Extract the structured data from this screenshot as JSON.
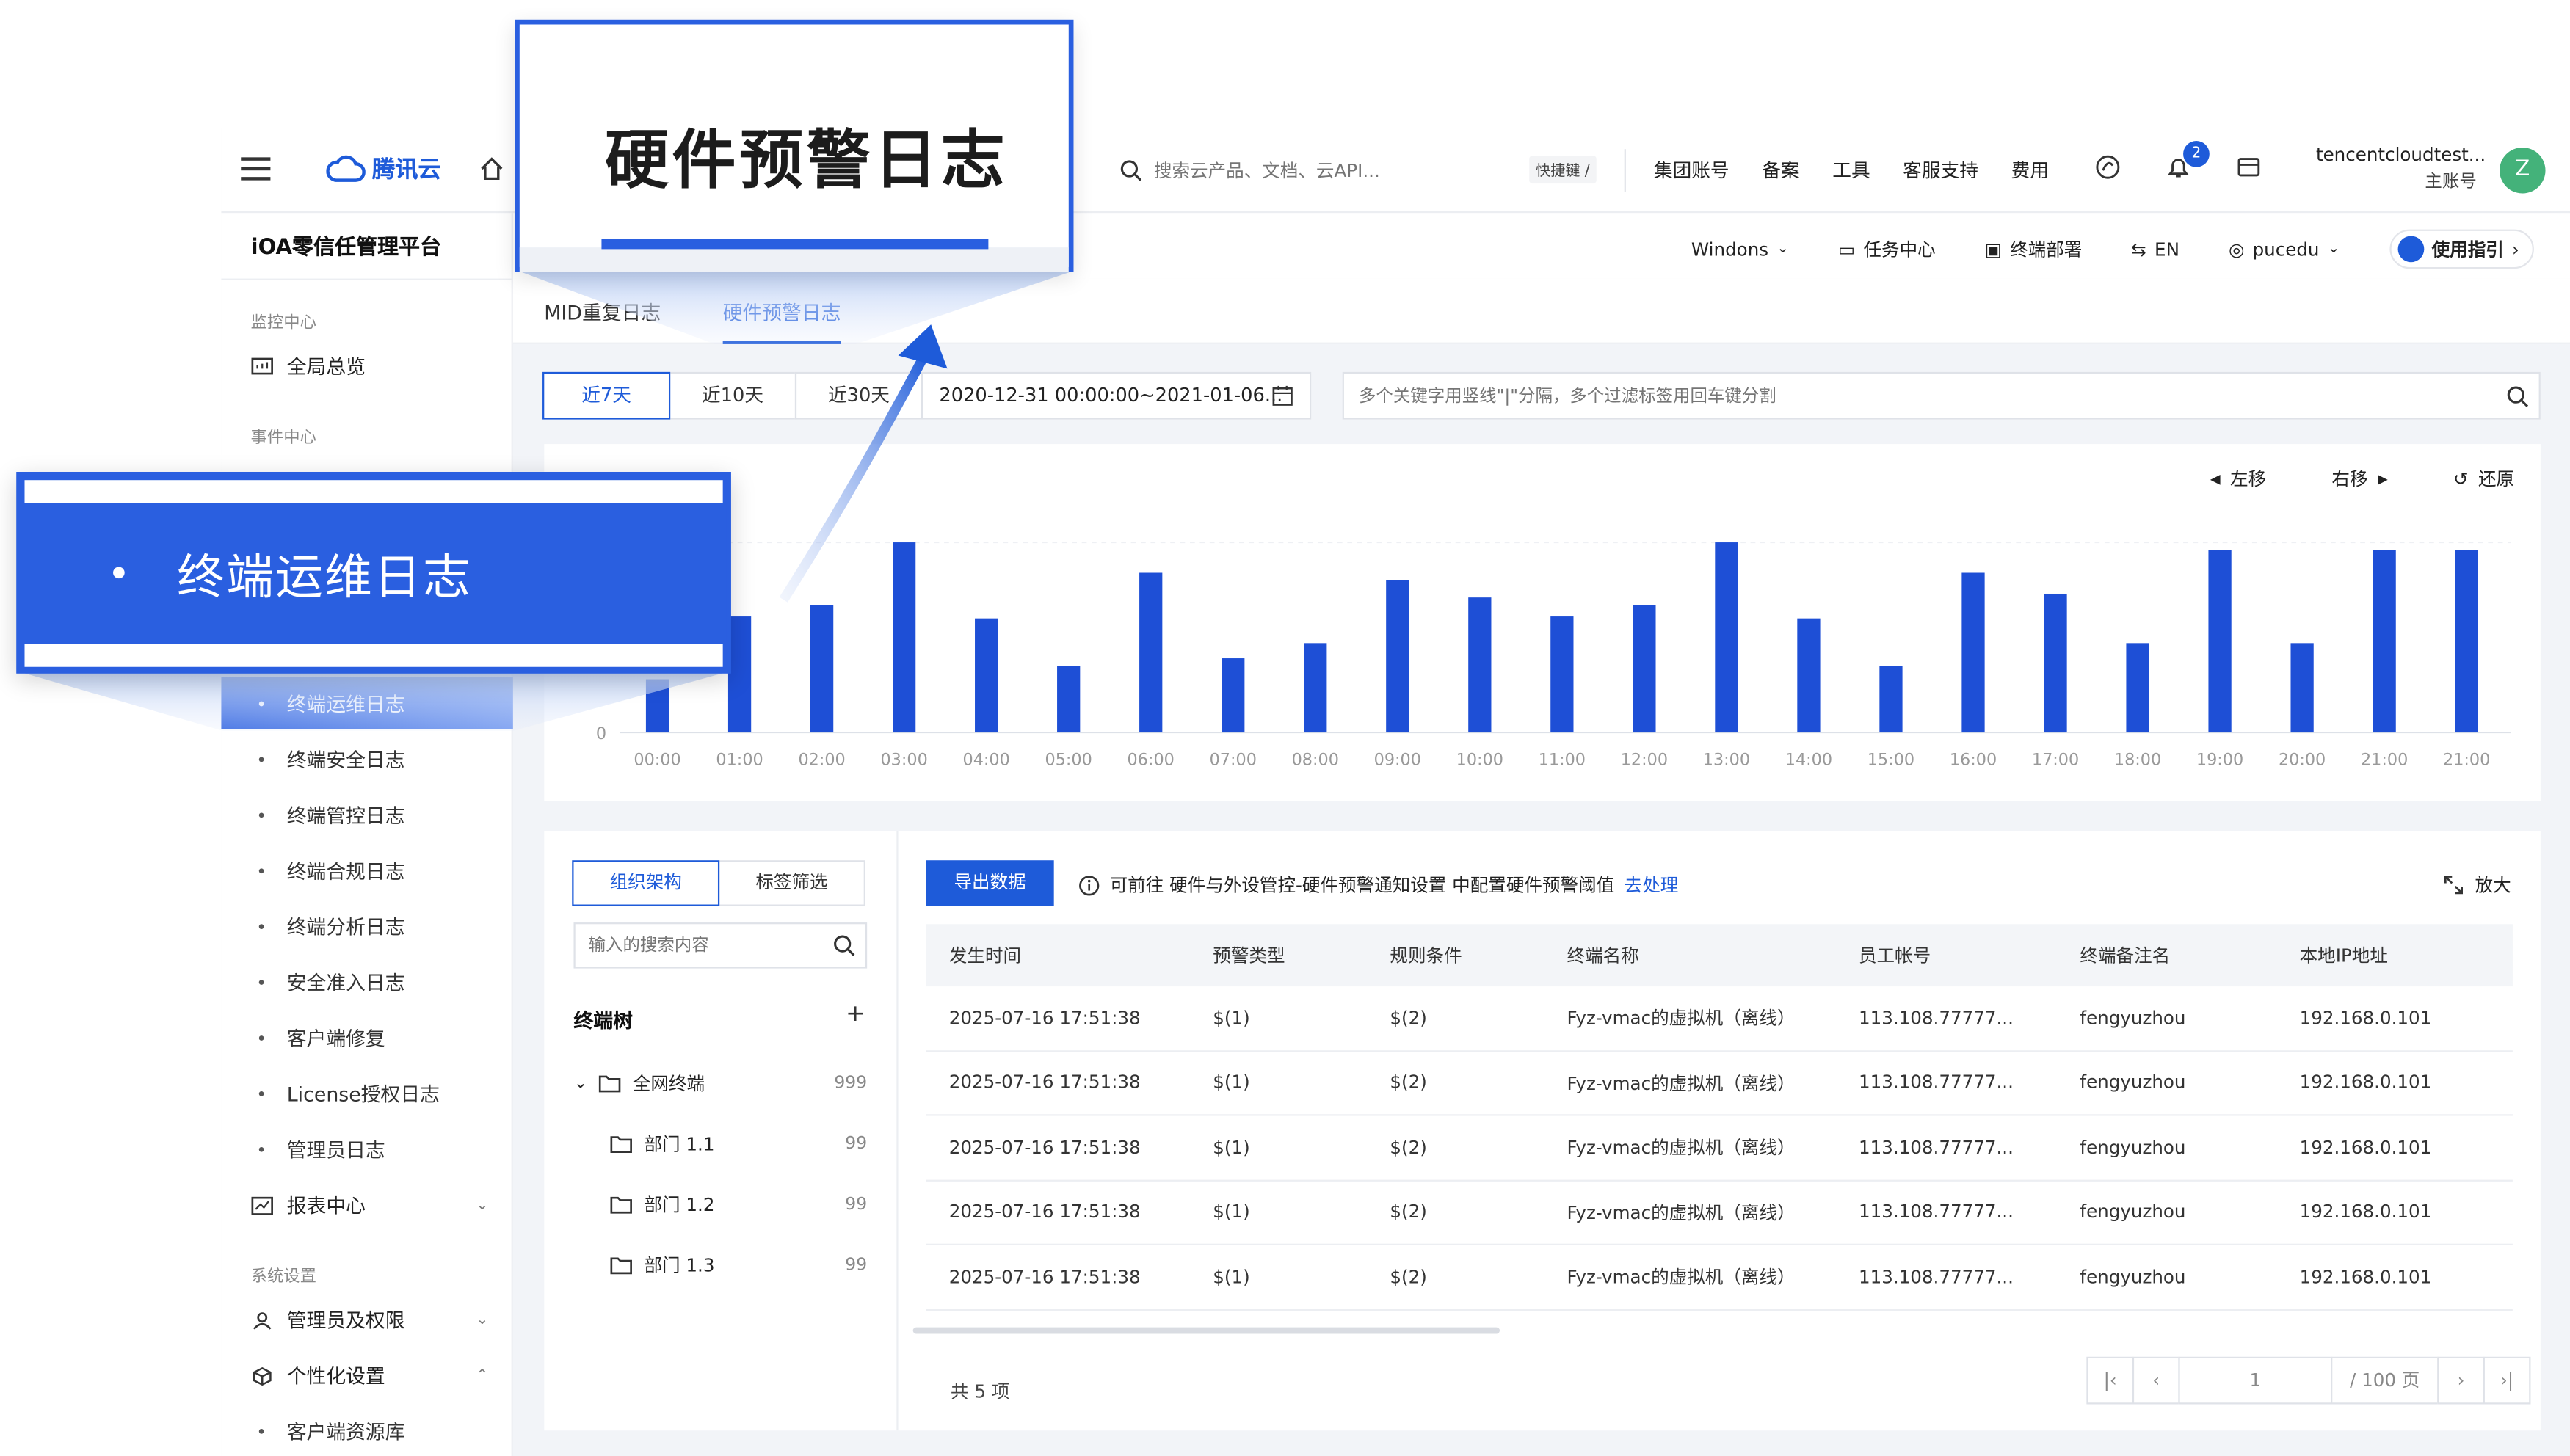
{
  "topbar": {
    "brand": "腾讯云",
    "search_placeholder": "搜索云产品、文档、云API...",
    "shortcut": "快捷键 /",
    "nav": [
      "集团账号",
      "备案",
      "工具",
      "客服支持",
      "费用"
    ],
    "notification_count": "2",
    "account_name": "tencentcloudtest...",
    "account_role": "主账号",
    "avatar_letter": "Z"
  },
  "sidebar": {
    "title": "iOA零信任管理平台",
    "group_monitor": "监控中心",
    "overview": "全局总览",
    "group_event": "事件中心",
    "log_items": [
      "终端运维日志",
      "终端安全日志",
      "终端管控日志",
      "终端合规日志",
      "终端分析日志",
      "安全准入日志",
      "客户端修复",
      "License授权日志",
      "管理员日志"
    ],
    "report_center": "报表中心",
    "group_system": "系统设置",
    "admin_permissions": "管理员及权限",
    "personalization": "个性化设置",
    "client_resources": "客户端资源库"
  },
  "subheader": {
    "os_select": "Windons",
    "task_center": "任务中心",
    "terminal_deploy": "终端部署",
    "language": "EN",
    "user": "pucedu",
    "guide": "使用指引"
  },
  "tabs": [
    "MID重复日志",
    "硬件预警日志"
  ],
  "filter": {
    "ranges": [
      "近7天",
      "近10天",
      "近30天"
    ],
    "active_range": 0,
    "date_range": "2020-12-31 00:00:00~2021-01-06...",
    "keyword_placeholder": "多个关键字用竖线\"|\"分隔，多个过滤标签用回车键分割"
  },
  "chart_controls": {
    "left": "左移",
    "right": "右移",
    "reset": "还原"
  },
  "chart_data": {
    "type": "bar",
    "categories": [
      "00:00",
      "01:00",
      "02:00",
      "03:00",
      "04:00",
      "05:00",
      "06:00",
      "07:00",
      "08:00",
      "09:00",
      "10:00",
      "11:00",
      "12:00",
      "13:00",
      "14:00",
      "15:00",
      "16:00",
      "17:00",
      "18:00",
      "19:00",
      "20:00",
      "21:00",
      "21:00"
    ],
    "values": [
      28,
      61,
      67,
      100,
      60,
      35,
      84,
      39,
      47,
      80,
      71,
      61,
      67,
      100,
      60,
      35,
      84,
      73,
      47,
      96,
      47,
      96,
      96
    ],
    "ylim": [
      0,
      100
    ],
    "y_ticks": [
      "0"
    ],
    "color": "#1e4fd6",
    "grid": true
  },
  "tree_panel": {
    "tabs": [
      "组织架构",
      "标签筛选"
    ],
    "search_placeholder": "输入的搜索内容",
    "title": "终端树",
    "nodes": [
      {
        "label": "全网终端",
        "count": "999"
      },
      {
        "label": "部门 1.1",
        "count": "99"
      },
      {
        "label": "部门 1.2",
        "count": "99"
      },
      {
        "label": "部门 1.3",
        "count": "99"
      }
    ]
  },
  "table_area": {
    "export": "导出数据",
    "notice_text": "可前往 硬件与外设管控-硬件预警通知设置 中配置硬件预警阈值",
    "notice_link": "去处理",
    "expand": "放大",
    "columns": [
      "发生时间",
      "预警类型",
      "规则条件",
      "终端名称",
      "员工帐号",
      "终端备注名",
      "本地IP地址"
    ],
    "rows": [
      [
        "2025-07-16 17:51:38",
        "$(1)",
        "$(2)",
        "Fyz-vmac的虚拟机（离线）",
        "113.108.77777...",
        "fengyuzhou",
        "192.168.0.101"
      ],
      [
        "2025-07-16 17:51:38",
        "$(1)",
        "$(2)",
        "Fyz-vmac的虚拟机（离线）",
        "113.108.77777...",
        "fengyuzhou",
        "192.168.0.101"
      ],
      [
        "2025-07-16 17:51:38",
        "$(1)",
        "$(2)",
        "Fyz-vmac的虚拟机（离线）",
        "113.108.77777...",
        "fengyuzhou",
        "192.168.0.101"
      ],
      [
        "2025-07-16 17:51:38",
        "$(1)",
        "$(2)",
        "Fyz-vmac的虚拟机（离线）",
        "113.108.77777...",
        "fengyuzhou",
        "192.168.0.101"
      ],
      [
        "2025-07-16 17:51:38",
        "$(1)",
        "$(2)",
        "Fyz-vmac的虚拟机（离线）",
        "113.108.77777...",
        "fengyuzhou",
        "192.168.0.101"
      ]
    ],
    "total": "共 5 项",
    "page_value": "1",
    "page_total": "/ 100 页"
  },
  "callouts": {
    "top_text": "硬件预警日志",
    "left_text": "终端运维日志"
  },
  "colors": {
    "primary": "#1e5bd9",
    "callout": "#2a5fe0",
    "avatar": "#44b27a"
  }
}
